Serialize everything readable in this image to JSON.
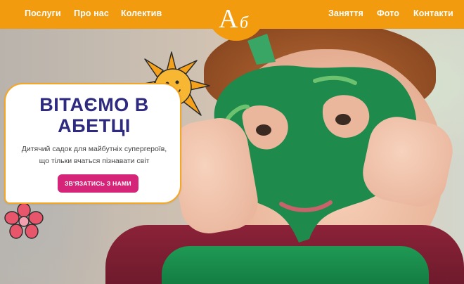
{
  "nav": {
    "left": [
      {
        "label": "Послуги"
      },
      {
        "label": "Про нас"
      },
      {
        "label": "Колектив"
      }
    ],
    "right": [
      {
        "label": "Заняття"
      },
      {
        "label": "Фото"
      },
      {
        "label": "Контакти"
      }
    ],
    "logo": {
      "first": "А",
      "second": "б"
    }
  },
  "hero": {
    "title_line1": "ВІТАЄМО В",
    "title_line2": "АБЕТЦІ",
    "subtitle_line1": "Дитячий садок для майбутніх супергероїв,",
    "subtitle_line2": "що тільки вчаться пізнавати світ",
    "cta_label": "ЗВ'ЯЗАТИСЬ З НАМИ"
  },
  "colors": {
    "header": "#f29b0e",
    "title": "#2e2a80",
    "cta": "#d42579",
    "card_border": "#f5a623",
    "mask": "#1e8a4c"
  },
  "icons": [
    "sun-icon",
    "flower-icon"
  ]
}
